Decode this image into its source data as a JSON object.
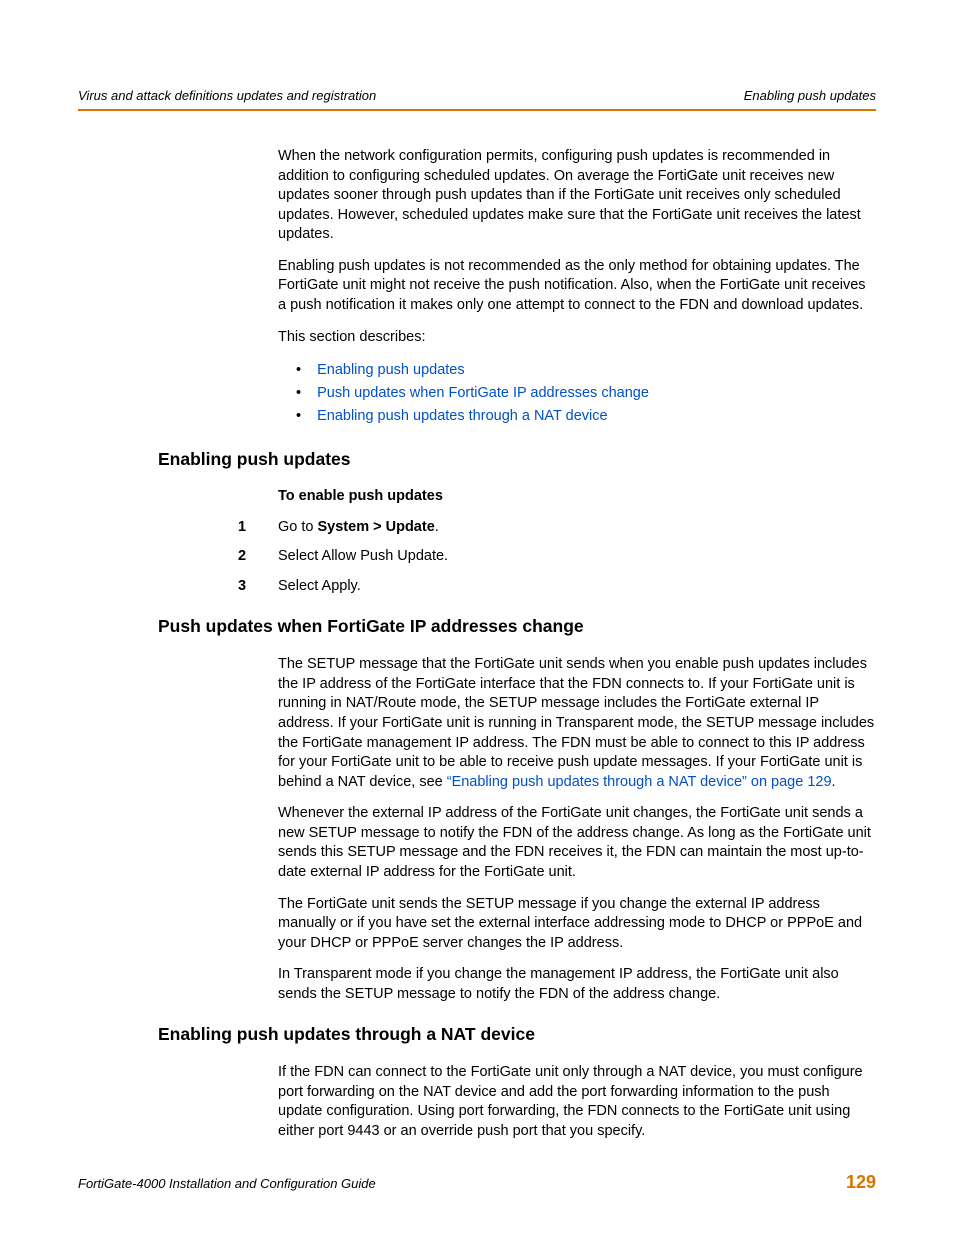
{
  "header": {
    "left": "Virus and attack definitions updates and registration",
    "right": "Enabling push updates"
  },
  "intro": {
    "p1": "When the network configuration permits, configuring push updates is recommended in addition to configuring scheduled updates. On average the FortiGate unit receives new updates sooner through push updates than if the FortiGate unit receives only scheduled updates. However, scheduled updates make sure that the FortiGate unit receives the latest updates.",
    "p2": "Enabling push updates is not recommended as the only method for obtaining updates. The FortiGate unit might not receive the push notification. Also, when the FortiGate unit receives a push notification it makes only one attempt to connect to the FDN and download updates.",
    "p3": "This section describes:"
  },
  "toc": {
    "i1": "Enabling push updates",
    "i2": "Push updates when FortiGate IP addresses change",
    "i3": "Enabling push updates through a NAT device"
  },
  "sec1": {
    "title": "Enabling push updates",
    "sub": "To enable push updates",
    "step1_pre": "Go to ",
    "step1_bold": "System > Update",
    "step1_post": ".",
    "step2": "Select Allow Push Update.",
    "step3": "Select Apply."
  },
  "sec2": {
    "title": "Push updates when FortiGate IP addresses change",
    "p1a": "The SETUP message that the FortiGate unit sends when you enable push updates includes the IP address of the FortiGate interface that the FDN connects to. If your FortiGate unit is running in NAT/Route mode, the SETUP message includes the FortiGate external IP address. If your FortiGate unit is running in Transparent mode, the SETUP message includes the FortiGate management IP address. The FDN must be able to connect to this IP address for your FortiGate unit to be able to receive push update messages. If your FortiGate unit is behind a NAT device, see ",
    "p1link": "“Enabling push updates through a NAT device” on page 129",
    "p1b": ".",
    "p2": "Whenever the external IP address of the FortiGate unit changes, the FortiGate unit sends a new SETUP message to notify the FDN of the address change. As long as the FortiGate unit sends this SETUP message and the FDN receives it, the FDN can maintain the most up-to-date external IP address for the FortiGate unit.",
    "p3": "The FortiGate unit sends the SETUP message if you change the external IP address manually or if you have set the external interface addressing mode to DHCP or PPPoE and your DHCP or PPPoE server changes the IP address.",
    "p4": "In Transparent mode if you change the management IP address, the FortiGate unit also sends the SETUP message to notify the FDN of the address change."
  },
  "sec3": {
    "title": "Enabling push updates through a NAT device",
    "p1": "If the FDN can connect to the FortiGate unit only through a NAT device, you must configure port forwarding on the NAT device and add the port forwarding information to the push update configuration. Using port forwarding, the FDN connects to the FortiGate unit using either port 9443 or an override push port that you specify."
  },
  "footer": {
    "left": "FortiGate-4000 Installation and Configuration Guide",
    "page": "129"
  }
}
